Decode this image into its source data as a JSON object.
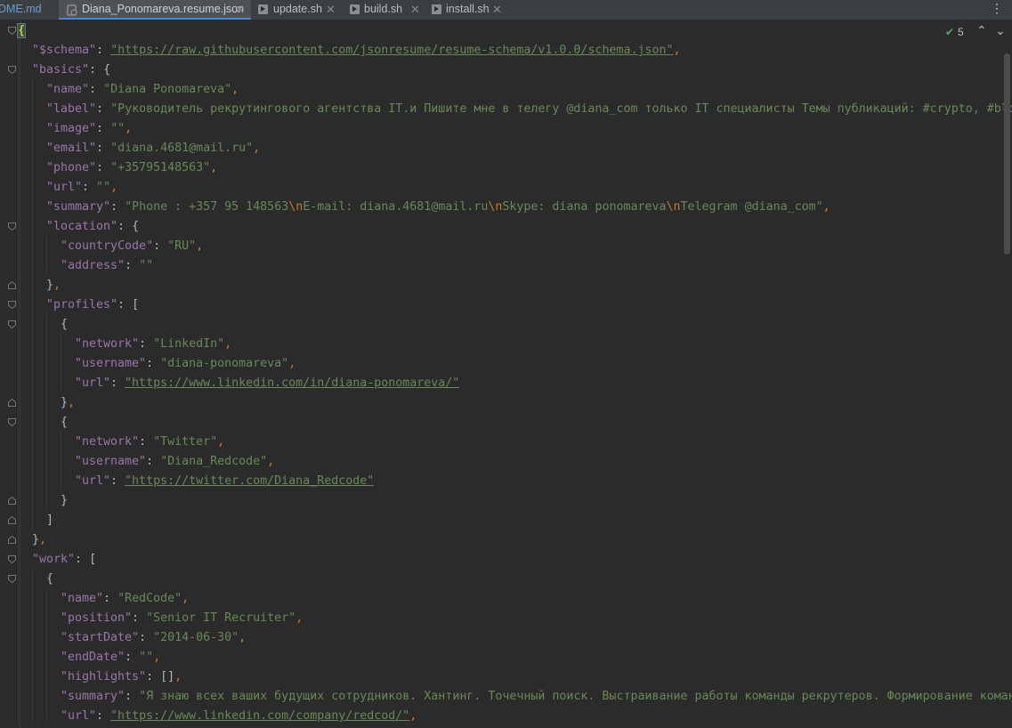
{
  "tabs": [
    {
      "label": "DME.md",
      "icon": "markdown-file-icon"
    },
    {
      "label": "Diana_Ponomareva.resume.json",
      "icon": "json-file-icon",
      "active": true
    },
    {
      "label": "update.sh",
      "icon": "shell-script-icon"
    },
    {
      "label": "build.sh",
      "icon": "shell-script-icon"
    },
    {
      "label": "install.sh",
      "icon": "shell-script-icon"
    }
  ],
  "status": {
    "inspection_count": "5"
  },
  "colors": {
    "key": "#9876aa",
    "string": "#6a8759",
    "punct": "#cc7832",
    "text": "#a9b7c6",
    "background": "#2b2b2b"
  },
  "code": {
    "l1": "{",
    "l2k": "\"$schema\"",
    "l2v": "\"https://raw.githubusercontent.com/jsonresume/resume-schema/v1.0.0/schema.json\"",
    "l3k": "\"basics\"",
    "l3o": "{",
    "l4k": "\"name\"",
    "l4v": "\"Diana Ponomareva\"",
    "l5k": "\"label\"",
    "l5v": "\"Руководитель рекрутингового агентства IT.и Пишите мне в телегу @diana_com только IT специалисты Темы публикаций: #crypto, #blo",
    "l6k": "\"image\"",
    "l6v": "\"\"",
    "l7k": "\"email\"",
    "l7v": "\"diana.4681@mail.ru\"",
    "l8k": "\"phone\"",
    "l8v": "\"+35795148563\"",
    "l9k": "\"url\"",
    "l9v": "\"\"",
    "l10k": "\"summary\"",
    "l10a": "\"Phone : +357 95 148563",
    "l10b": "E-mail: diana.4681@mail.ru",
    "l10c": "Skype: diana ponomareva",
    "l10d": "Telegram @diana_com\"",
    "esc": "\\n",
    "l11k": "\"location\"",
    "l11o": "{",
    "l12k": "\"countryCode\"",
    "l12v": "\"RU\"",
    "l13k": "\"address\"",
    "l13v": "\"\"",
    "l14": "}",
    "l15k": "\"profiles\"",
    "l15o": "[",
    "l16": "{",
    "l17k": "\"network\"",
    "l17v": "\"LinkedIn\"",
    "l18k": "\"username\"",
    "l18v": "\"diana-ponomareva\"",
    "l19k": "\"url\"",
    "l19v": "\"https://www.linkedin.com/in/diana-ponomareva/\"",
    "l20": "}",
    "l21": "{",
    "l22k": "\"network\"",
    "l22v": "\"Twitter\"",
    "l23k": "\"username\"",
    "l23v": "\"Diana_Redcode\"",
    "l24k": "\"url\"",
    "l24v": "\"https://twitter.com/Diana_Redcode\"",
    "l25": "}",
    "l26": "]",
    "l27": "}",
    "l28k": "\"work\"",
    "l28o": "[",
    "l29": "{",
    "l30k": "\"name\"",
    "l30v": "\"RedCode\"",
    "l31k": "\"position\"",
    "l31v": "\"Senior IT Recruiter\"",
    "l32k": "\"startDate\"",
    "l32v": "\"2014-06-30\"",
    "l33k": "\"endDate\"",
    "l33v": "\"\"",
    "l34k": "\"highlights\"",
    "l34v": "[]",
    "l35k": "\"summary\"",
    "l35v": "\"Я знаю всех ваших будущих сотрудников. Хантинг. Точечный поиск. Выстраивание работы команды рекрутеров. Формирование коман",
    "l36k": "\"url\"",
    "l36v": "\"https://www.linkedin.com/company/redcod/\""
  }
}
